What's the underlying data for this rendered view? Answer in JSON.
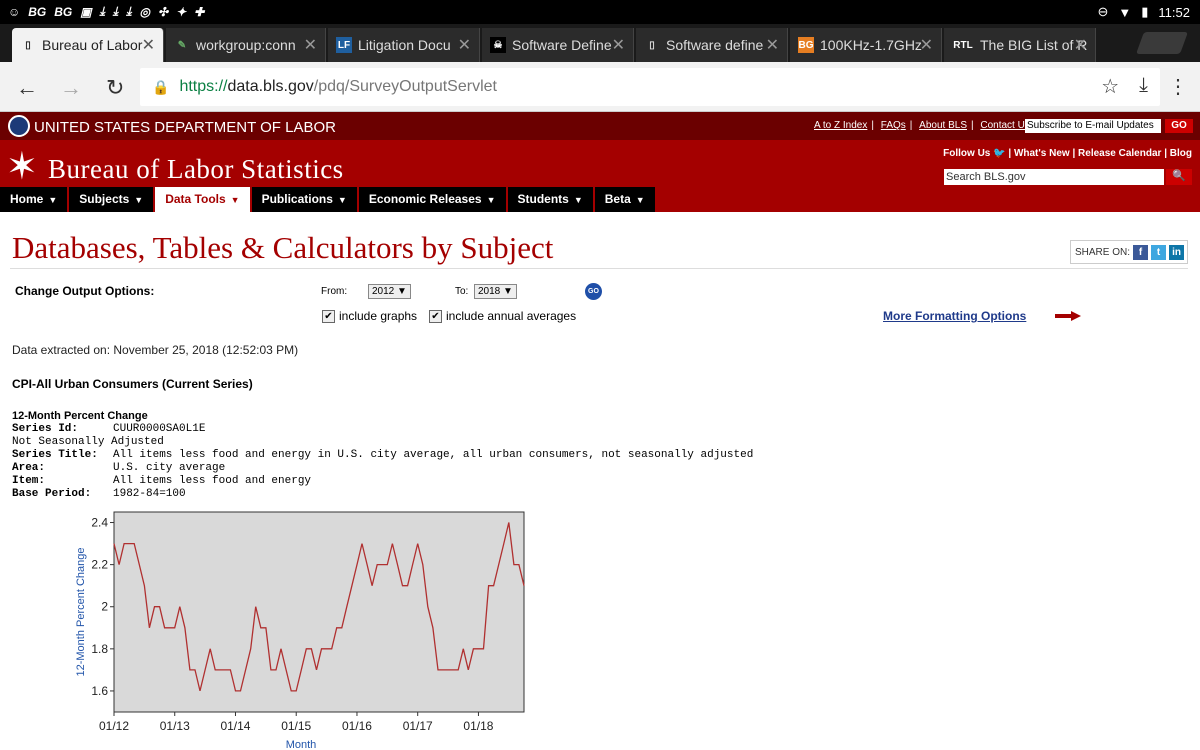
{
  "status_bar": {
    "left_items": [
      "BG",
      "BG"
    ],
    "time": "11:52"
  },
  "tabs": [
    {
      "title": "Bureau of Labor",
      "icon": "page-icon",
      "active": true
    },
    {
      "title": "workgroup:conn",
      "icon": "brush-icon",
      "active": false
    },
    {
      "title": "Litigation Docu",
      "icon": "lf-icon",
      "active": false
    },
    {
      "title": "Software Define",
      "icon": "pirate-icon",
      "active": false
    },
    {
      "title": "Software define",
      "icon": "page-icon",
      "active": false
    },
    {
      "title": "100KHz-1.7GHz",
      "icon": "bg-icon",
      "active": false
    },
    {
      "title": "The BIG List of R",
      "icon": "rtl-icon",
      "active": false
    }
  ],
  "url": {
    "scheme": "https://",
    "host": "data.bls.gov",
    "path": "/pdq/SurveyOutputServlet"
  },
  "dol": {
    "title": "UNITED STATES DEPARTMENT OF LABOR",
    "links": [
      "A to Z Index",
      "FAQs",
      "About BLS",
      "Contact Us"
    ],
    "subscribe_placeholder": "Subscribe to E-mail Updates",
    "go_label": "GO"
  },
  "bls": {
    "title": "Bureau of Labor Statistics",
    "follow": "Follow Us",
    "links": [
      "What's New",
      "Release Calendar",
      "Blog"
    ],
    "search_placeholder": "Search BLS.gov"
  },
  "nav": [
    "Home",
    "Subjects",
    "Data Tools",
    "Publications",
    "Economic Releases",
    "Students",
    "Beta"
  ],
  "nav_active": "Data Tools",
  "page": {
    "title": "Databases, Tables & Calculators by Subject",
    "share_label": "SHARE ON:",
    "change_options": "Change Output Options:",
    "from_label": "From:",
    "from_value": "2012",
    "to_label": "To:",
    "to_value": "2018",
    "go_label": "GO",
    "include_graphs": "include graphs",
    "include_annual": "include annual averages",
    "more_formatting": "More Formatting Options",
    "extracted": "Data extracted on: November 25, 2018 (12:52:03 PM)",
    "series_heading": "CPI-All Urban Consumers (Current Series)",
    "pct_heading": "12-Month Percent Change"
  },
  "series_meta": {
    "id_label": "Series Id:",
    "id_value": "CUUR0000SA0L1E",
    "adjust": "Not Seasonally Adjusted",
    "title_label": "Series Title:",
    "title_value": "All items less food and energy in U.S. city average, all urban consumers, not seasonally adjusted",
    "area_label": "Area:",
    "area_value": "U.S. city average",
    "item_label": "Item:",
    "item_value": "All items less food and energy",
    "base_label": "Base Period:",
    "base_value": "1982-84=100"
  },
  "colors": {
    "bls_red": "#a40000",
    "dol_dark": "#6b0000",
    "line": "#b03030",
    "plot_bg": "#d9d9d9",
    "axis_label": "#2255aa"
  },
  "chart_data": {
    "type": "line",
    "xlabel": "Month",
    "ylabel": "12-Month Percent Change",
    "ylim": [
      1.5,
      2.45
    ],
    "yticks": [
      "1.6",
      "1.8",
      "2",
      "2.2",
      "2.4"
    ],
    "xticks": [
      "01/12",
      "01/13",
      "01/14",
      "01/15",
      "01/16",
      "01/17",
      "01/18"
    ],
    "series": [
      {
        "values": [
          2.3,
          2.2,
          2.3,
          2.3,
          2.3,
          2.2,
          2.1,
          1.9,
          2.0,
          2.0,
          1.9,
          1.9,
          1.9,
          2.0,
          1.9,
          1.7,
          1.7,
          1.6,
          1.7,
          1.8,
          1.7,
          1.7,
          1.7,
          1.7,
          1.6,
          1.6,
          1.7,
          1.8,
          2.0,
          1.9,
          1.9,
          1.7,
          1.7,
          1.8,
          1.7,
          1.6,
          1.6,
          1.7,
          1.8,
          1.8,
          1.7,
          1.8,
          1.8,
          1.8,
          1.9,
          1.9,
          2.0,
          2.1,
          2.2,
          2.3,
          2.2,
          2.1,
          2.2,
          2.2,
          2.2,
          2.3,
          2.2,
          2.1,
          2.1,
          2.2,
          2.3,
          2.2,
          2.0,
          1.9,
          1.7,
          1.7,
          1.7,
          1.7,
          1.7,
          1.8,
          1.7,
          1.8,
          1.8,
          1.8,
          2.1,
          2.1,
          2.2,
          2.3,
          2.4,
          2.2,
          2.2,
          2.1
        ]
      }
    ]
  }
}
